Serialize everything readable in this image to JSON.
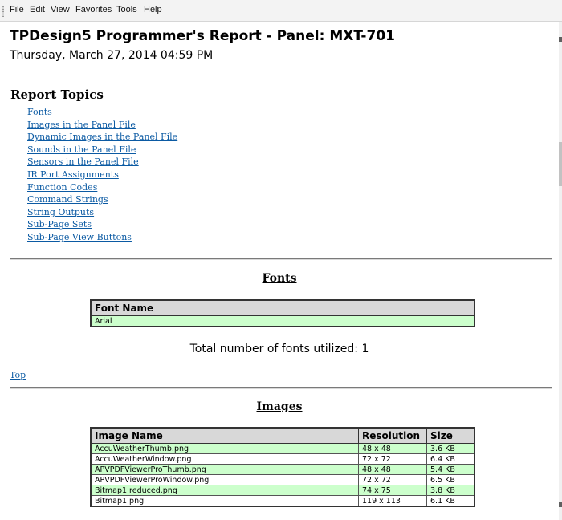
{
  "menu": [
    "File",
    "Edit",
    "View",
    "Favorites",
    "Tools",
    "Help"
  ],
  "report": {
    "title": "TPDesign5 Programmer's Report - Panel: MXT-701",
    "date": "Thursday, March 27, 2014 04:59 PM"
  },
  "topics": {
    "heading": "Report Topics",
    "items": [
      "Fonts",
      "Images in the Panel File",
      "Dynamic Images in the Panel File",
      "Sounds in the Panel File",
      "Sensors in the Panel File",
      "IR Port Assignments",
      "Function Codes",
      "Command Strings",
      "String Outputs",
      "Sub-Page Sets",
      "Sub-Page View Buttons"
    ]
  },
  "fonts_section": {
    "title": "Fonts",
    "column": "Font Name",
    "rows": [
      "Arial"
    ],
    "total": "Total number of fonts utilized: 1",
    "top_link": "Top"
  },
  "images_section": {
    "title": "Images",
    "columns": [
      "Image Name",
      "Resolution",
      "Size"
    ],
    "rows": [
      [
        "AccuWeatherThumb.png",
        "48 x 48",
        "3.6 KB"
      ],
      [
        "AccuWeatherWindow.png",
        "72 x 72",
        "6.4 KB"
      ],
      [
        "APVPDFViewerProThumb.png",
        "48 x 48",
        "5.4 KB"
      ],
      [
        "APVPDFViewerProWindow.png",
        "72 x 72",
        "6.5 KB"
      ],
      [
        "Bitmap1 reduced.png",
        "74 x 75",
        "3.8 KB"
      ],
      [
        "Bitmap1.png",
        "119 x 113",
        "6.1 KB"
      ]
    ]
  },
  "colors": {
    "link": "#0b5aa3",
    "row_alt": "#ccffcc",
    "header_bg": "#d8d8d8"
  }
}
